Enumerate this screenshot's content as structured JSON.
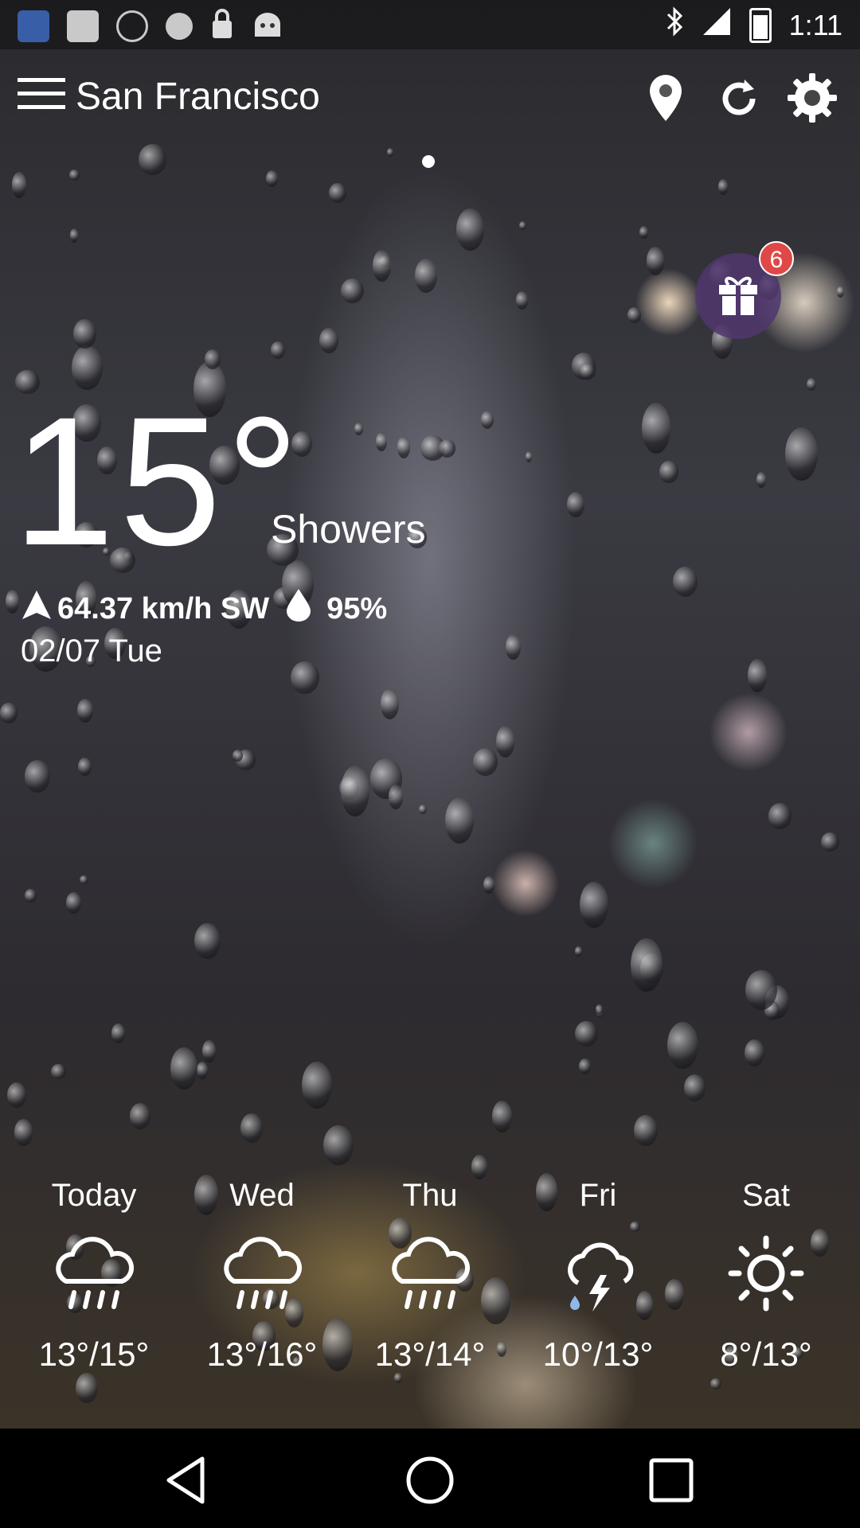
{
  "status_bar": {
    "time": "1:11",
    "left_icons": [
      "english-keyboard-icon",
      "fake-gps-icon",
      "satellite-icon",
      "info-icon",
      "lock-icon",
      "android-icon"
    ],
    "right_icons": [
      "bluetooth-icon",
      "signal-icon",
      "battery-icon"
    ]
  },
  "header": {
    "city": "San Francisco",
    "icons": [
      "menu-icon",
      "location-pin-icon",
      "refresh-icon",
      "settings-gear-icon"
    ]
  },
  "gift": {
    "badge_count": "6"
  },
  "current": {
    "temperature": "15°",
    "condition": "Showers",
    "wind": "64.37 km/h SW",
    "humidity": "95%",
    "date": "02/07 Tue"
  },
  "forecast": [
    {
      "day": "Today",
      "range": "13°/15°",
      "icon": "rain-cloud-icon"
    },
    {
      "day": "Wed",
      "range": "13°/16°",
      "icon": "rain-cloud-icon"
    },
    {
      "day": "Thu",
      "range": "13°/14°",
      "icon": "rain-cloud-icon"
    },
    {
      "day": "Fri",
      "range": "10°/13°",
      "icon": "thunderstorm-icon"
    },
    {
      "day": "Sat",
      "range": "8°/13°",
      "icon": "sun-icon"
    }
  ],
  "nav_bar": {
    "icons": [
      "back-icon",
      "home-icon",
      "recents-icon"
    ]
  }
}
